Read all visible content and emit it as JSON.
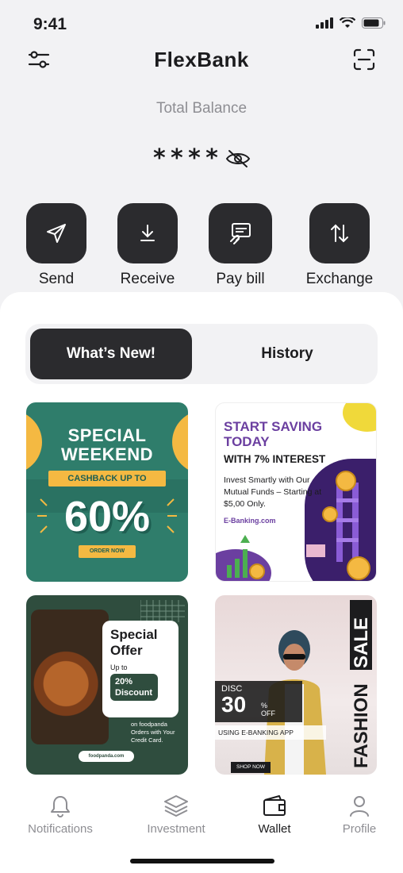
{
  "status": {
    "time": "9:41"
  },
  "header": {
    "title": "FlexBank",
    "left_icon": "sliders-icon",
    "right_icon": "scan-icon"
  },
  "balance": {
    "label": "Total Balance",
    "value": "****",
    "visibility_icon": "eye-off-icon"
  },
  "actions": [
    {
      "label": "Send",
      "icon": "send-icon"
    },
    {
      "label": "Receive",
      "icon": "download-icon"
    },
    {
      "label": "Pay bill",
      "icon": "bill-icon"
    },
    {
      "label": "Exchange",
      "icon": "exchange-icon"
    }
  ],
  "segments": {
    "active": "What’s New!",
    "inactive": "History"
  },
  "promos": {
    "special_weekend": {
      "title_line1": "SPECIAL",
      "title_line2": "WEEKEND",
      "cashback": "CASHBACK UP TO",
      "percent": "60%",
      "cta": "ORDER NOW"
    },
    "saving": {
      "title_line1": "START SAVING",
      "title_line2": "TODAY",
      "subtitle": "WITH 7% INTEREST",
      "body": "Invest Smartly with Our Mutual Funds – Starting at $5,00 Only.",
      "site": "E-Banking.com"
    },
    "special_offer": {
      "title_line1": "Special",
      "title_line2": "Offer",
      "up_to": "Up to",
      "discount_pct": "20%",
      "discount_label": "Discount",
      "note": "on foodpanda Orders with Your Credit Card.",
      "site": "foodpanda.com"
    },
    "fashion": {
      "disc_label": "DISC",
      "disc_value": "30",
      "disc_pct": "%",
      "disc_off": "OFF",
      "using": "USING E-BANKING APP",
      "shop": "SHOP NOW",
      "word1": "SALE",
      "word2": "FASHION"
    }
  },
  "tabbar": [
    {
      "label": "Notifications",
      "icon": "bell-icon",
      "active": false
    },
    {
      "label": "Investment",
      "icon": "layers-icon",
      "active": false
    },
    {
      "label": "Wallet",
      "icon": "wallet-icon",
      "active": true
    },
    {
      "label": "Profile",
      "icon": "user-icon",
      "active": false
    }
  ],
  "colors": {
    "dark_button": "#2b2b2e",
    "accent_green": "#2f7d6b",
    "accent_purple": "#6b3fa0",
    "accent_yellow": "#f4b942"
  }
}
